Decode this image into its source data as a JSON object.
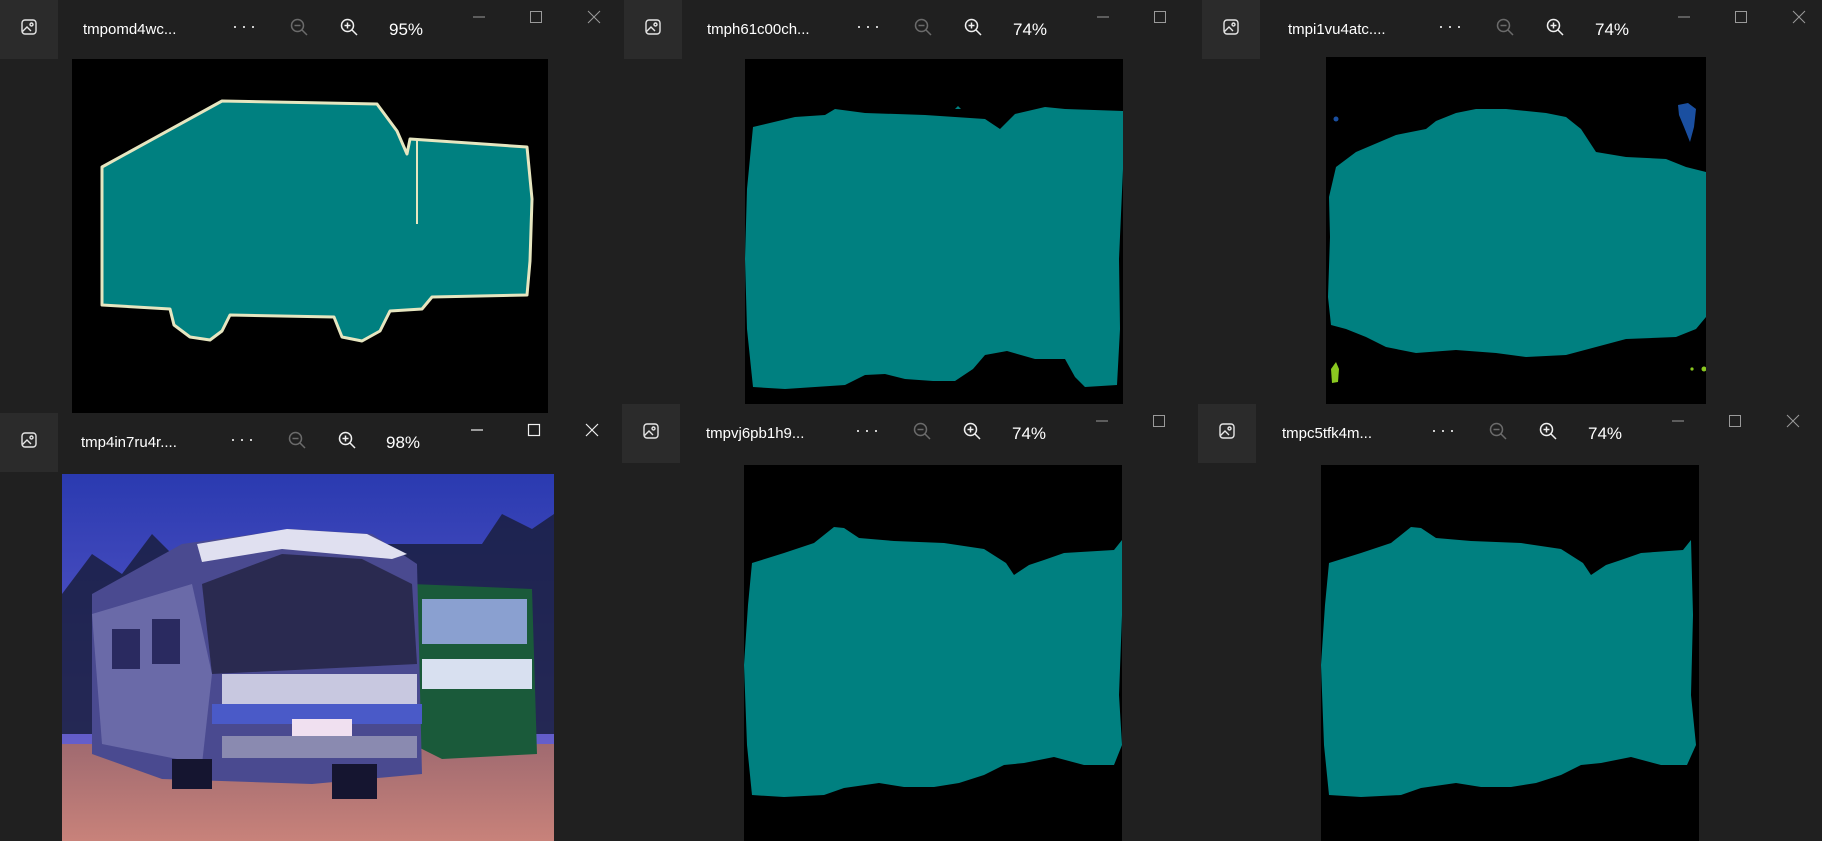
{
  "windows": [
    {
      "title": "tmpomd4wc...",
      "zoom": "95%"
    },
    {
      "title": "tmph61c00ch...",
      "zoom": "74%"
    },
    {
      "title": "tmpi1vu4atc....",
      "zoom": "74%"
    },
    {
      "title": "tmp4in7ru4r....",
      "zoom": "98%"
    },
    {
      "title": "tmpvj6pb1h9...",
      "zoom": "74%"
    },
    {
      "title": "tmpc5tfk4m...",
      "zoom": "74%"
    }
  ],
  "controls": {
    "more": "···"
  },
  "icons": [
    "image-icon",
    "zoom-out-icon",
    "zoom-in-icon",
    "minimize-icon",
    "maximize-icon",
    "close-icon"
  ],
  "colors": {
    "teal": "#008080",
    "outline": "#e6e6c0",
    "blue_blob": "#1a4fa0",
    "green_blob": "#8ac820",
    "bg": "#202020",
    "title_button": "#2b2b2b"
  }
}
